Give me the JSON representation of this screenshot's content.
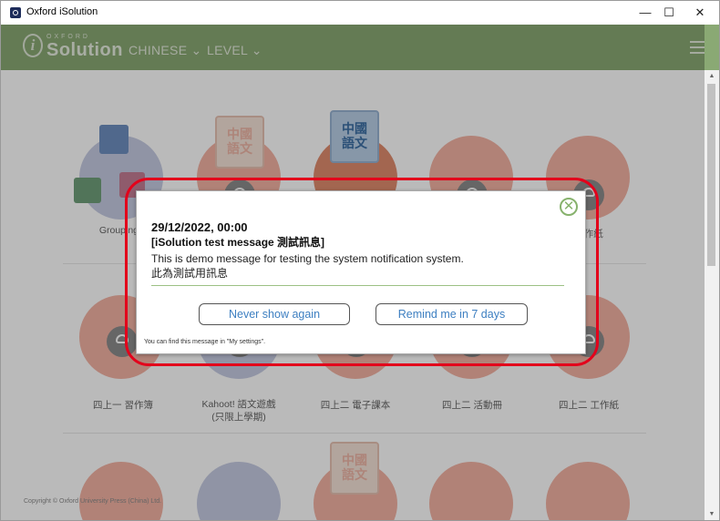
{
  "window": {
    "title": "Oxford iSolution",
    "controls": {
      "minimize": "—",
      "maximize": "☐",
      "close": "✕"
    }
  },
  "header": {
    "logo_small": "OXFORD",
    "logo_main": "Solution",
    "logo_letter": "i",
    "nav": [
      {
        "label": "CHINESE ⌄"
      },
      {
        "label": "LEVEL ⌄"
      }
    ]
  },
  "content": {
    "row1_labels": [
      "Grouping T",
      "",
      "",
      "",
      "工作紙"
    ],
    "row2_labels": [
      "四上一 習作簿",
      "Kahoot! 語文遊戲\n(只限上學期)",
      "四上二 電子課本",
      "四上二 活動冊",
      "四上二 工作紙"
    ],
    "book_text": "中國\n語文",
    "copyright": "Copyright © Oxford University Press (China) Ltd."
  },
  "dialog": {
    "close_icon": "✕",
    "date": "29/12/2022, 00:00",
    "title": "[iSolution test message 測試訊息]",
    "body_en": "This is demo message for testing the system notification system.",
    "body_zh": "此為測試用訊息",
    "never_show_label": "Never show again",
    "remind_label": "Remind me in 7 days",
    "hint": "You can find this message in \"My settings\"."
  },
  "colors": {
    "header_bg": "#8aa974",
    "accent_green": "#87b26d",
    "link_blue": "#3d7fc1",
    "annotation_red": "#e3001b"
  }
}
